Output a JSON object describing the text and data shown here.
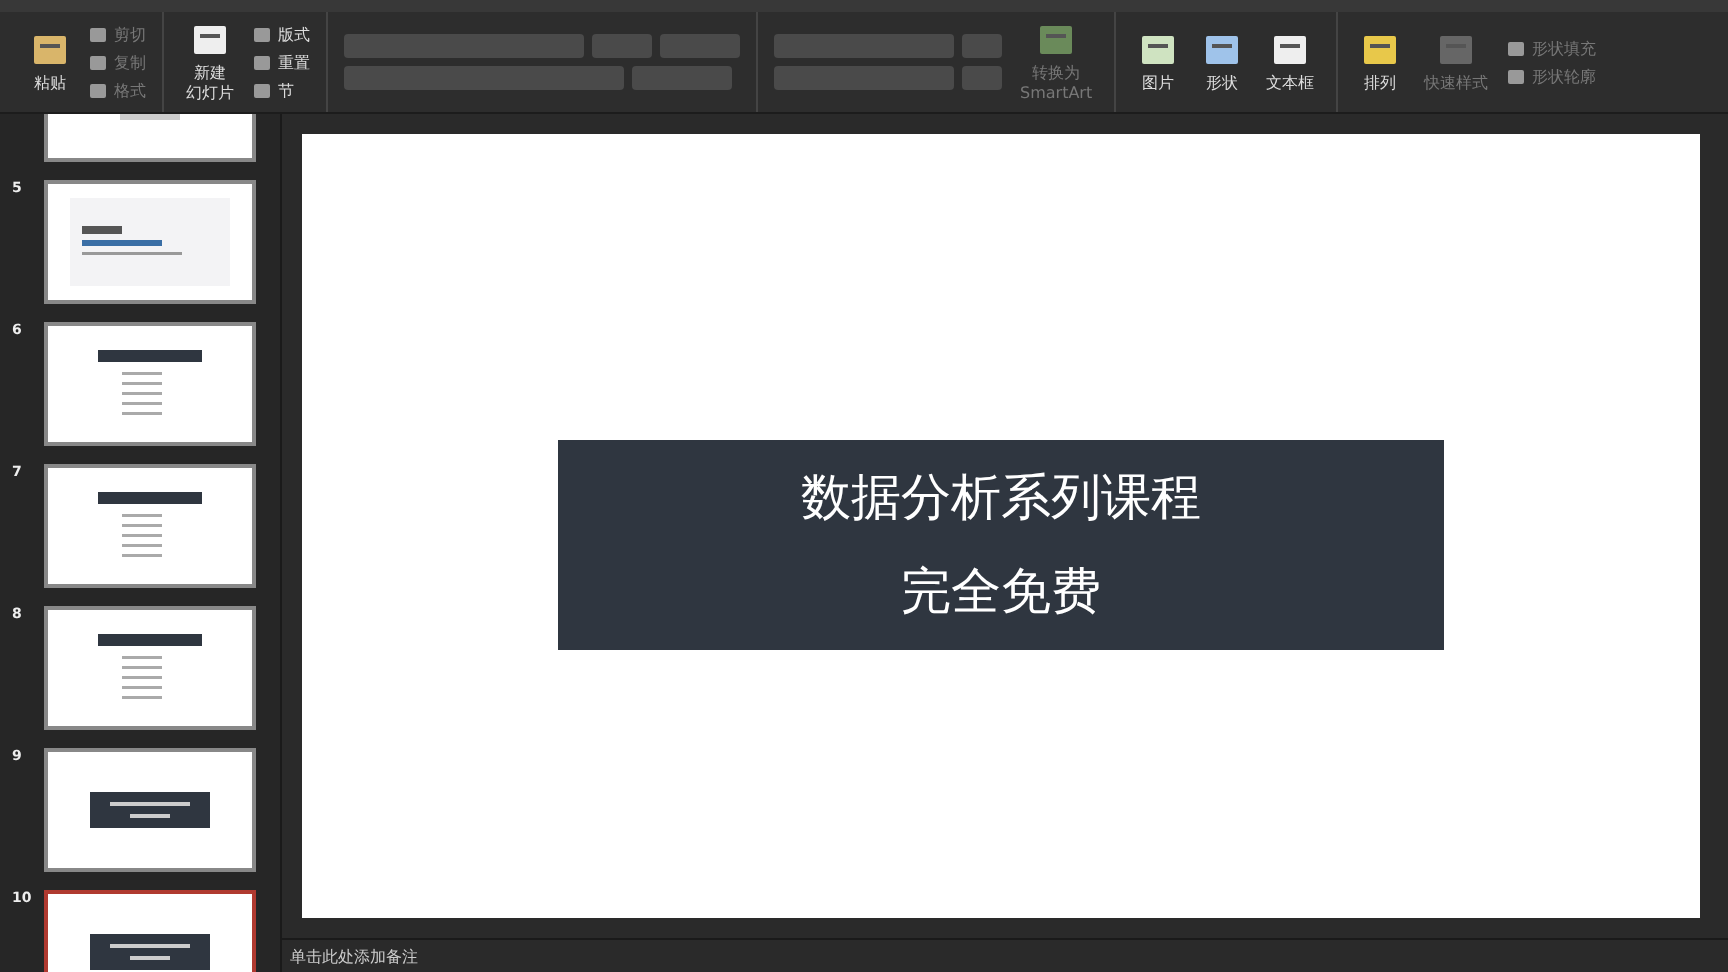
{
  "ribbon": {
    "groups": [
      {
        "items": [
          {
            "kind": "large",
            "lines": [
              "粘贴"
            ],
            "disabled": false
          },
          {
            "kind": "small",
            "label": "剪切",
            "disabled": true
          },
          {
            "kind": "small",
            "label": "复制",
            "disabled": true
          },
          {
            "kind": "small",
            "label": "格式",
            "disabled": true
          }
        ]
      },
      {
        "items": [
          {
            "kind": "large",
            "lines": [
              "新建",
              "幻灯片"
            ],
            "disabled": false
          },
          {
            "kind": "small",
            "label": "版式",
            "disabled": false
          },
          {
            "kind": "small",
            "label": "重置",
            "disabled": false
          },
          {
            "kind": "small",
            "label": "节",
            "disabled": false
          }
        ]
      },
      {
        "items": [
          {
            "kind": "font"
          }
        ]
      },
      {
        "items": [
          {
            "kind": "paragraph"
          },
          {
            "kind": "large",
            "lines": [
              "转换为",
              "SmartArt"
            ],
            "disabled": true
          }
        ]
      },
      {
        "items": [
          {
            "kind": "large",
            "lines": [
              "图片"
            ],
            "disabled": false
          },
          {
            "kind": "large",
            "lines": [
              "形状"
            ],
            "disabled": false
          },
          {
            "kind": "large",
            "lines": [
              "文本框"
            ],
            "disabled": false
          }
        ]
      },
      {
        "items": [
          {
            "kind": "large",
            "lines": [
              "排列"
            ],
            "disabled": false
          },
          {
            "kind": "large",
            "lines": [
              "快速样式"
            ],
            "disabled": true
          },
          {
            "kind": "small",
            "label": "形状填充",
            "disabled": true
          },
          {
            "kind": "small",
            "label": "形状轮廓",
            "disabled": true
          }
        ]
      }
    ]
  },
  "slides": [
    {
      "kind": "table",
      "selected": false
    },
    {
      "number": "5",
      "kind": "cover",
      "selected": false
    },
    {
      "number": "6",
      "kind": "bullets",
      "selected": false
    },
    {
      "number": "7",
      "kind": "bullets",
      "selected": false
    },
    {
      "number": "8",
      "kind": "bullets",
      "selected": false
    },
    {
      "number": "9",
      "kind": "title",
      "selected": false
    },
    {
      "number": "10",
      "kind": "title",
      "selected": true
    }
  ],
  "current_slide": {
    "lines": [
      "数据分析系列课程",
      "完全免费"
    ]
  },
  "notes": {
    "placeholder": "单击此处添加备注"
  }
}
